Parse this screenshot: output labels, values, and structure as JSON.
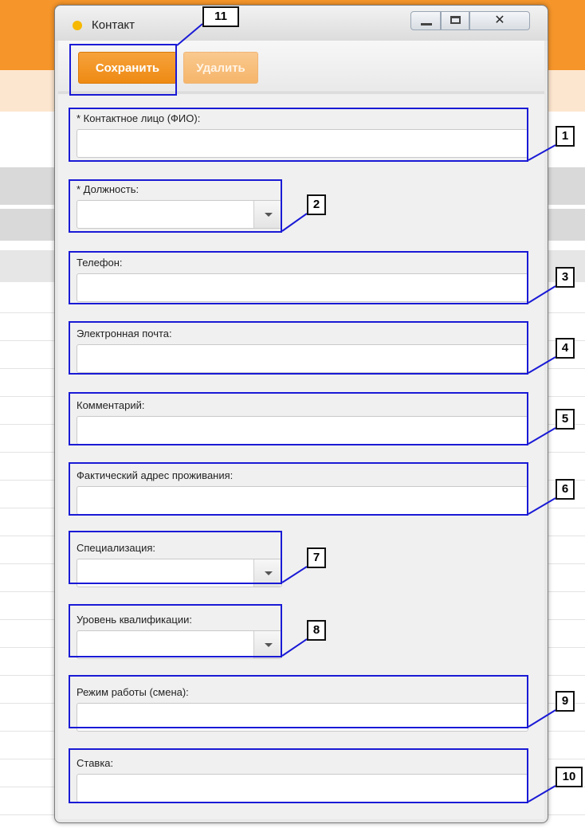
{
  "window": {
    "title": "Контакт",
    "buttons": {
      "save_label": "Сохранить",
      "delete_label": "Удалить"
    },
    "accent_color": "#f39323"
  },
  "fields": {
    "contact_person": {
      "label": "* Контактное лицо (ФИО):",
      "value": ""
    },
    "position": {
      "label": "* Должность:",
      "value": ""
    },
    "phone": {
      "label": "Телефон:",
      "value": ""
    },
    "email": {
      "label": "Электронная почта:",
      "value": ""
    },
    "comment": {
      "label": "Комментарий:",
      "value": ""
    },
    "address": {
      "label": "Фактический адрес проживания:",
      "value": ""
    },
    "specialization": {
      "label": "Специализация:",
      "value": ""
    },
    "qualification": {
      "label": "Уровень квалификации:",
      "value": ""
    },
    "work_mode": {
      "label": "Режим работы (смена):",
      "value": ""
    },
    "rate": {
      "label": "Ставка:",
      "value": ""
    }
  },
  "annotations": [
    "1",
    "2",
    "3",
    "4",
    "5",
    "6",
    "7",
    "8",
    "9",
    "10",
    "11"
  ],
  "icons": {
    "app": "app-dot-icon",
    "minimize": "minimize-icon",
    "maximize": "maximize-icon",
    "close": "close-icon",
    "dropdown": "chevron-down-icon"
  }
}
